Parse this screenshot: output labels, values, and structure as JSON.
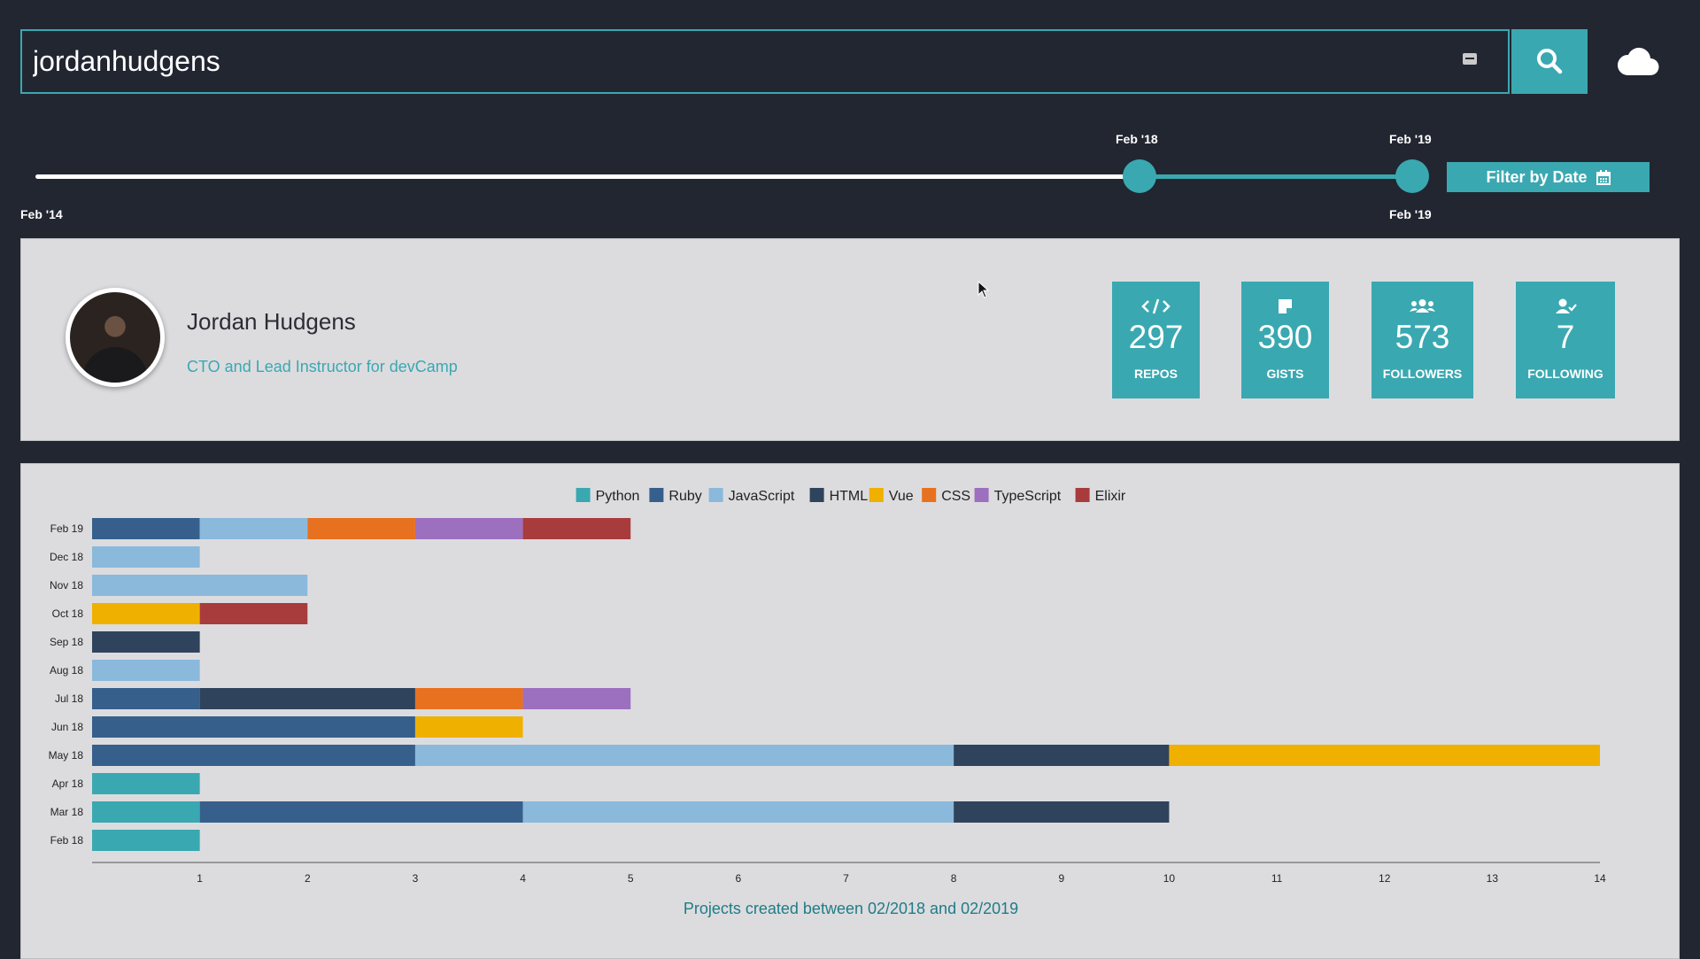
{
  "search": {
    "value": "jordanhudgens"
  },
  "slider": {
    "start_label": "Feb '14",
    "handle_low_label": "Feb '18",
    "handle_high_label_top": "Feb '19",
    "handle_high_label_bottom": "Feb '19",
    "filter_button_label": "Filter by Date"
  },
  "profile": {
    "name": "Jordan Hudgens",
    "bio": "CTO and Lead Instructor for devCamp",
    "stats": [
      {
        "value": "297",
        "label": "REPOS",
        "icon": "code-icon"
      },
      {
        "value": "390",
        "label": "GISTS",
        "icon": "sticky-note-icon"
      },
      {
        "value": "573",
        "label": "FOLLOWERS",
        "icon": "users-icon"
      },
      {
        "value": "7",
        "label": "FOLLOWING",
        "icon": "user-check-icon"
      }
    ]
  },
  "colors": {
    "accent": "#3aa8b1",
    "background": "#222631",
    "panel": "#dcdcdf"
  },
  "chart_data": {
    "type": "bar",
    "orientation": "horizontal",
    "stacked": true,
    "categories": [
      "Feb 19",
      "Dec 18",
      "Nov 18",
      "Oct 18",
      "Sep 18",
      "Aug 18",
      "Jul 18",
      "Jun 18",
      "May 18",
      "Apr 18",
      "Mar 18",
      "Feb 18"
    ],
    "series": [
      {
        "name": "Python",
        "color": "#3aa8b1",
        "values": [
          0,
          0,
          0,
          0,
          0,
          0,
          0,
          0,
          0,
          1,
          1,
          1
        ]
      },
      {
        "name": "Ruby",
        "color": "#365f8c",
        "values": [
          1,
          0,
          0,
          0,
          0,
          0,
          1,
          3,
          3,
          0,
          3,
          0
        ]
      },
      {
        "name": "JavaScript",
        "color": "#8ab9dc",
        "values": [
          1,
          1,
          2,
          0,
          0,
          1,
          0,
          0,
          5,
          0,
          4,
          0
        ]
      },
      {
        "name": "HTML",
        "color": "#2f435c",
        "values": [
          0,
          0,
          0,
          0,
          1,
          0,
          2,
          0,
          2,
          0,
          2,
          0
        ]
      },
      {
        "name": "Vue",
        "color": "#f0b000",
        "values": [
          0,
          0,
          0,
          1,
          0,
          0,
          0,
          1,
          4,
          0,
          0,
          0
        ]
      },
      {
        "name": "CSS",
        "color": "#e8711f",
        "values": [
          1,
          0,
          0,
          0,
          0,
          0,
          1,
          0,
          0,
          0,
          0,
          0
        ]
      },
      {
        "name": "TypeScript",
        "color": "#9c6fbf",
        "values": [
          1,
          0,
          0,
          0,
          0,
          0,
          1,
          0,
          0,
          0,
          0,
          0
        ]
      },
      {
        "name": "Elixir",
        "color": "#a83c3c",
        "values": [
          1,
          0,
          0,
          1,
          0,
          0,
          0,
          0,
          0,
          0,
          0,
          0
        ]
      }
    ],
    "xlim": [
      0,
      14
    ],
    "xticks": [
      1,
      2,
      3,
      4,
      5,
      6,
      7,
      8,
      9,
      10,
      11,
      12,
      13,
      14
    ],
    "legend_position": "top-center",
    "xlabel": "Projects created between 02/2018 and 02/2019"
  }
}
